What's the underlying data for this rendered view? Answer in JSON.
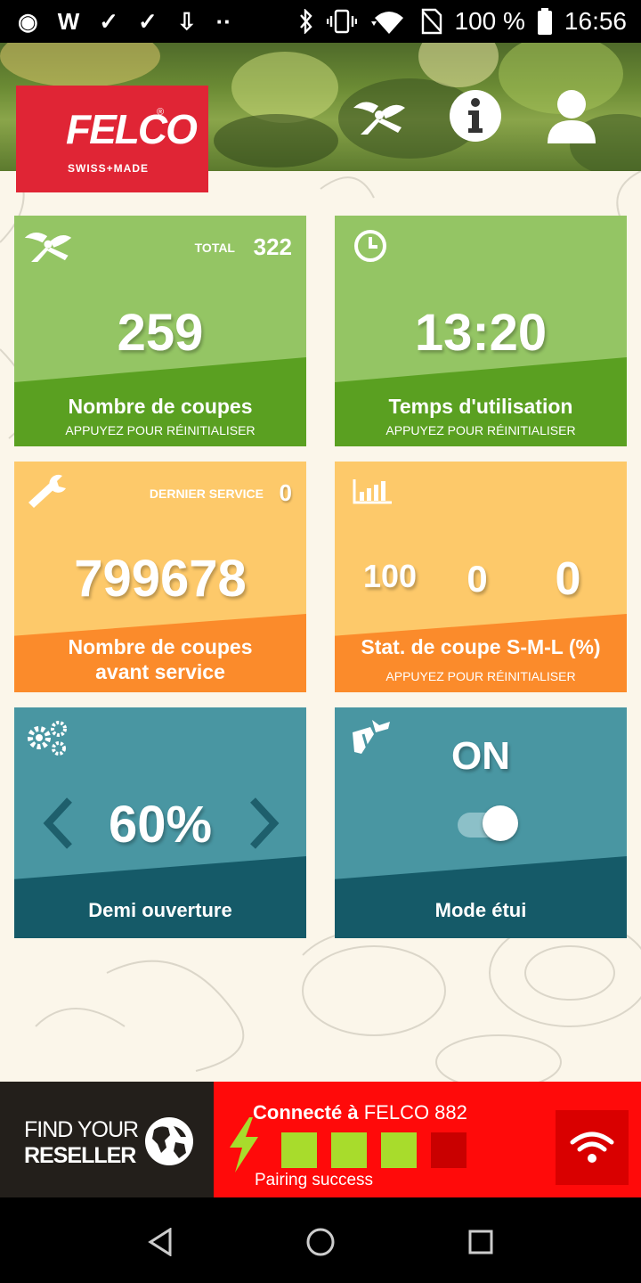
{
  "status_bar": {
    "time": "16:56",
    "battery": "100 %",
    "left_icons": [
      "app-icon",
      "w-app-icon",
      "check-icon",
      "check-icon",
      "download-icon",
      "more-dots-icon"
    ],
    "left_glyphs": [
      "◉",
      "W",
      "✓",
      "✓",
      "⇩",
      "··"
    ],
    "right_icons": [
      "bluetooth-icon",
      "vibrate-icon",
      "wifi-icon",
      "no-sim-icon",
      "battery-icon"
    ]
  },
  "header": {
    "brand": "FELCO",
    "registered": "®",
    "tagline": "SWISS+MADE",
    "icons": [
      "pruner-icon",
      "info-icon",
      "user-icon"
    ]
  },
  "tiles": {
    "cuts": {
      "total_label": "TOTAL",
      "total_value": "322",
      "value": "259",
      "label": "Nombre de coupes",
      "sub": "APPUYEZ POUR RÉINITIALISER"
    },
    "time": {
      "value": "13:20",
      "label": "Temps d'utilisation",
      "sub": "APPUYEZ POUR RÉINITIALISER"
    },
    "service": {
      "last_label": "DERNIER SERVICE",
      "last_value": "0",
      "value": "799678",
      "label_line1": "Nombre de coupes",
      "label_line2": "avant service"
    },
    "stats": {
      "s": "100",
      "m": "0",
      "l": "0",
      "label": "Stat. de coupe S-M-L (%)",
      "sub": "APPUYEZ POUR RÉINITIALISER"
    },
    "opening": {
      "value": "60%",
      "label": "Demi ouverture"
    },
    "holster": {
      "value": "ON",
      "toggle_on": true,
      "label": "Mode étui"
    }
  },
  "bottom": {
    "reseller_line1": "FIND YOUR",
    "reseller_line2": "RESELLER",
    "connected_prefix": "Connecté à",
    "device_name": "FELCO 882",
    "signal_level": 3,
    "signal_max": 4,
    "status": "Pairing success"
  },
  "colors": {
    "felco_red": "#e02535",
    "green_light": "#94c564",
    "green_dark": "#5aa021",
    "yellow_light": "#fdc96a",
    "orange": "#fb8b2b",
    "teal_light": "#4996a2",
    "teal_dark": "#155a68",
    "conn_red": "#ff0a0a",
    "signal_on": "#a8dc2c",
    "signal_off": "#c90000"
  }
}
